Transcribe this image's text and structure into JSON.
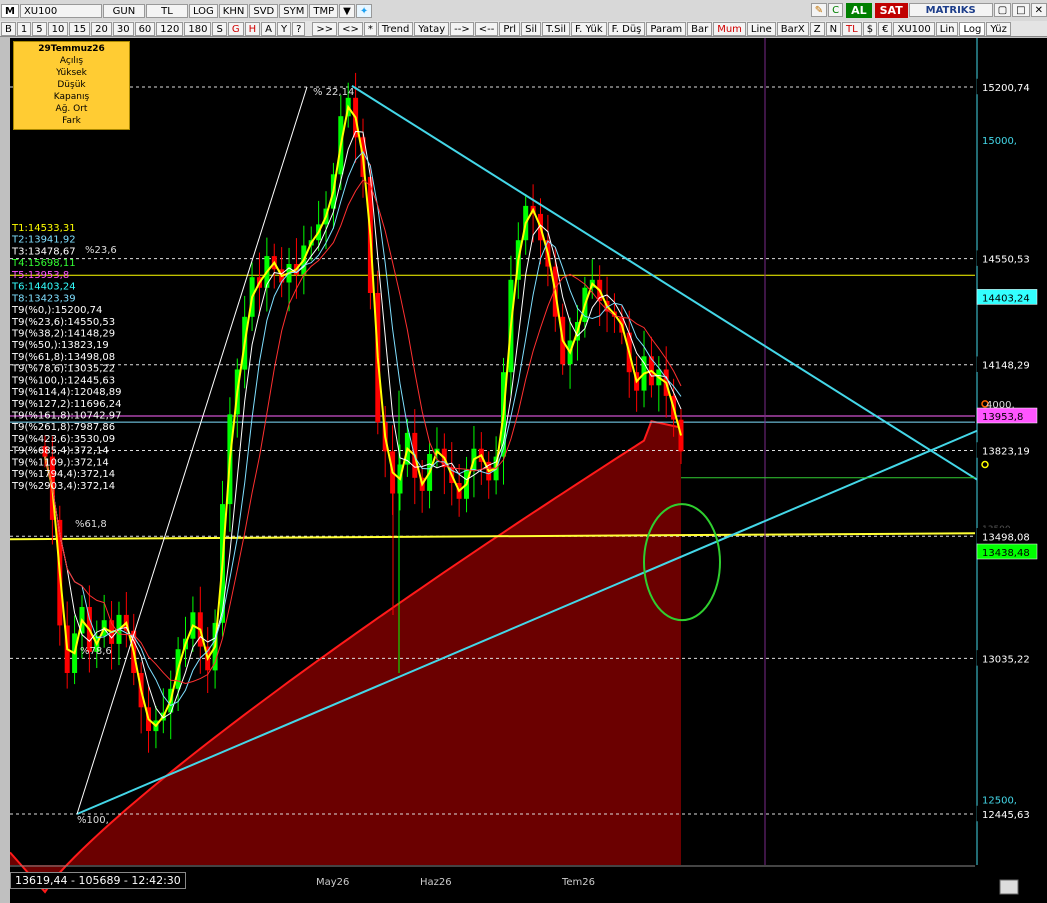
{
  "toolbar1": {
    "icon_label": "M",
    "symbol": "XU100",
    "period": "GUN",
    "currency": "TL",
    "log_label": "LOG",
    "buttons": [
      "KHN",
      "SVD",
      "SYM",
      "TMP"
    ],
    "buy": "AL",
    "sell": "SAT",
    "brand": "MATRIKS"
  },
  "toolbar2": {
    "left": [
      "B",
      "1",
      "5",
      "10",
      "15",
      "20",
      "30",
      "60",
      "120",
      "180",
      "S",
      "G",
      "H",
      "A",
      "Y",
      "?"
    ],
    "mid": [
      ">>",
      "<>",
      "*",
      "Trend",
      "Yatay",
      "-->",
      "<--",
      "Prl",
      "Sil",
      "T.Sil",
      "F. Yük",
      "F. Düş",
      "Param",
      "Bar",
      "Mum",
      "Line",
      "BarX",
      "Z",
      "N",
      "TL",
      "$",
      "€",
      "XU100",
      "Lin",
      "Log",
      "Yüz"
    ]
  },
  "ohlc_box": {
    "date": "29Temmuz26",
    "labels": [
      "Açılış",
      "Yüksek",
      "Düşük",
      "Kapanış",
      "Ağ. Ort",
      "Fark"
    ]
  },
  "status_bar": "13619,44 - 105689 - 12:42:30",
  "indicators": [
    {
      "text": "T1:14533,31",
      "color": "#ffff00"
    },
    {
      "text": "T2:13941,92",
      "color": "#7fdfff"
    },
    {
      "text": "T3:13478,67",
      "color": "#ffffff"
    },
    {
      "text": "T4:15698,11",
      "color": "#33ff33"
    },
    {
      "text": "T5:13953,8",
      "color": "#ff55ff"
    },
    {
      "text": "T6:14403,24",
      "color": "#33ffff"
    },
    {
      "text": "T8:13423,39",
      "color": "#7fdfff"
    },
    {
      "text": "T9(%0,):15200,74",
      "color": "#ffffff"
    },
    {
      "text": "T9(%23,6):14550,53",
      "color": "#ffffff"
    },
    {
      "text": "T9(%38,2):14148,29",
      "color": "#ffffff"
    },
    {
      "text": "T9(%50,):13823,19",
      "color": "#ffffff"
    },
    {
      "text": "T9(%61,8):13498,08",
      "color": "#ffffff"
    },
    {
      "text": "T9(%78,6):13035,22",
      "color": "#ffffff"
    },
    {
      "text": "T9(%100,):12445,63",
      "color": "#ffffff"
    },
    {
      "text": "T9(%114,4):12048,89",
      "color": "#ffffff"
    },
    {
      "text": "T9(%127,2):11696,24",
      "color": "#ffffff"
    },
    {
      "text": "T9(%161,8):10742,97",
      "color": "#ffffff"
    },
    {
      "text": "T9(%261,8):7987,86",
      "color": "#ffffff"
    },
    {
      "text": "T9(%423,6):3530,09",
      "color": "#ffffff"
    },
    {
      "text": "T9(%685,4):372,14",
      "color": "#ffffff"
    },
    {
      "text": "T9(%1109,):372,14",
      "color": "#ffffff"
    },
    {
      "text": "T9(%1794,4):372,14",
      "color": "#ffffff"
    },
    {
      "text": "T9(%2903,4):372,14",
      "color": "#ffffff"
    }
  ],
  "chart_data": {
    "type": "candlestick",
    "symbol": "XU100",
    "ylim": [
      12250,
      15450
    ],
    "x_ticks": [
      "May26",
      "Haz26",
      "Tem26"
    ],
    "y_ticks": [
      15000,
      12500
    ],
    "price_tags": [
      {
        "value": "15200,74",
        "price": 15200.74,
        "bg": "#000000",
        "fg": "#ffffff"
      },
      {
        "value": "14550,53",
        "price": 14550.53,
        "bg": "#000000",
        "fg": "#ffffff"
      },
      {
        "value": "14403,24",
        "price": 14403.24,
        "bg": "#33ffff",
        "fg": "#000000"
      },
      {
        "value": "14148,29",
        "price": 14148.29,
        "bg": "#000000",
        "fg": "#ffffff"
      },
      {
        "value": "13953,8",
        "price": 13953.8,
        "bg": "#ff55ff",
        "fg": "#000000"
      },
      {
        "value": "13823,19",
        "price": 13823.19,
        "bg": "#000000",
        "fg": "#ffffff"
      },
      {
        "value": "13498,08",
        "price": 13498.08,
        "bg": "#000000",
        "fg": "#ffffff"
      },
      {
        "value": "13438,48",
        "price": 13438.48,
        "bg": "#00ff00",
        "fg": "#000000"
      },
      {
        "value": "13035,22",
        "price": 13035.22,
        "bg": "#000000",
        "fg": "#ffffff"
      },
      {
        "value": "12445,63",
        "price": 12445.63,
        "bg": "#000000",
        "fg": "#ffffff"
      }
    ],
    "fib_labels": [
      {
        "text": "% 22,14",
        "price": 15200.74
      },
      {
        "text": "%23,6",
        "price": 14550.53
      },
      {
        "text": "%61,8",
        "price": 13498.08
      },
      {
        "text": "%78,6",
        "price": 13035.22
      },
      {
        "text": "%100,",
        "price": 12445.63
      }
    ],
    "partial_tick_14000": "4000,",
    "partial_tick_13500": "13500",
    "closes": [
      13800,
      13560,
      13160,
      12980,
      13130,
      13230,
      13060,
      13120,
      13180,
      13090,
      13200,
      13140,
      12980,
      12850,
      12760,
      12800,
      12830,
      12920,
      13070,
      13110,
      13210,
      13080,
      12990,
      13170,
      13620,
      13960,
      14130,
      14330,
      14480,
      14440,
      14560,
      14510,
      14460,
      14530,
      14490,
      14600,
      14620,
      14680,
      14740,
      14870,
      15090,
      15160,
      15010,
      14860,
      14420,
      13930,
      13820,
      13660,
      13770,
      13890,
      13720,
      13670,
      13810,
      13830,
      13760,
      13700,
      13640,
      13750,
      13830,
      13780,
      13710,
      13800,
      14120,
      14470,
      14620,
      14750,
      14720,
      14620,
      14520,
      14330,
      14150,
      14240,
      14310,
      14440,
      14470,
      14390,
      14350,
      14330,
      14270,
      14120,
      14050,
      14180,
      14070,
      14130,
      14030,
      13940,
      13820
    ]
  },
  "colors": {
    "background": "#000000",
    "candle_up": "#00ff00",
    "candle_down": "#ff0000",
    "area_fill": "#6b0000",
    "area_edge": "#ff1a1a",
    "trendline": "#44d7e8",
    "ma_fast": "#ffff00",
    "ellipse": "#2fcf2f"
  }
}
